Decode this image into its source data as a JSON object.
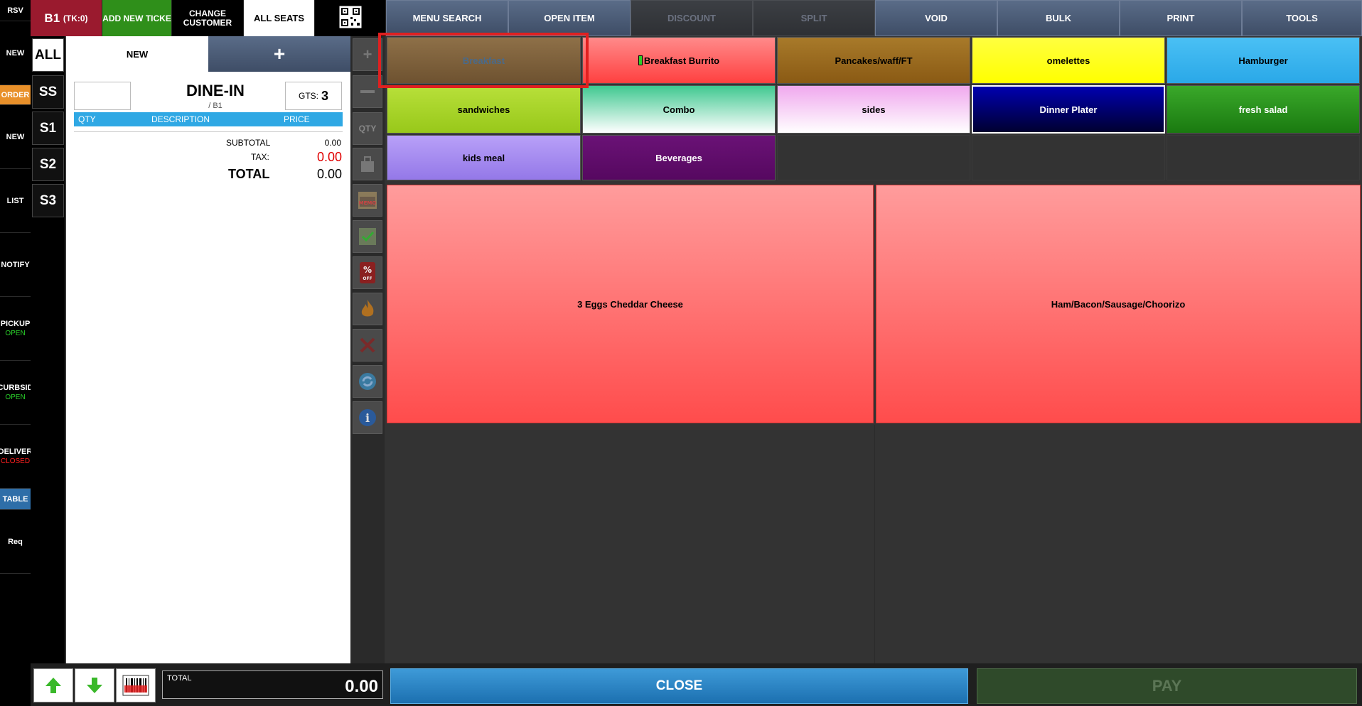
{
  "left_nav": [
    {
      "label": "RSV",
      "sub": ""
    },
    {
      "label": "NEW",
      "sub": ""
    },
    {
      "label": "ORDER",
      "sub": ""
    },
    {
      "label": "NEW",
      "sub": ""
    },
    {
      "label": "LIST",
      "sub": ""
    },
    {
      "label": "NOTIFY",
      "sub": ""
    },
    {
      "label": "PICKUP",
      "sub": "OPEN"
    },
    {
      "label": "CURBSID",
      "sub": "OPEN"
    },
    {
      "label": "DELIVER",
      "sub": "CLOSED"
    },
    {
      "label": "TABLE",
      "sub": ""
    },
    {
      "label": "Req",
      "sub": ""
    }
  ],
  "header": {
    "table_label": "B1",
    "table_sub": "(TK:0)",
    "add_ticket": "ADD NEW TICKE",
    "change_customer": "CHANGE CUSTOMER",
    "all_seats": "ALL SEATS",
    "menu_buttons": [
      "MENU SEARCH",
      "OPEN ITEM",
      "DISCOUNT",
      "SPLIT",
      "VOID",
      "BULK",
      "PRINT",
      "TOOLS"
    ]
  },
  "seats": [
    "ALL",
    "SS",
    "S1",
    "S2",
    "S3"
  ],
  "ticket": {
    "tab_new": "NEW",
    "tab_plus": "+",
    "order_type": "DINE-IN",
    "order_sub": "/ B1",
    "gts_label": "GTS:",
    "gts_value": "3",
    "col_qty": "QTY",
    "col_desc": "DESCRIPTION",
    "col_price": "PRICE",
    "subtotal_label": "SUBTOTAL",
    "subtotal_value": "0.00",
    "tax_label": "TAX:",
    "tax_value": "0.00",
    "total_label": "TOTAL",
    "total_value": "0.00"
  },
  "tools": [
    "plus-icon",
    "minus-icon",
    "QTY",
    "bag-icon",
    "memo-icon",
    "checklist-icon",
    "percent-off-icon",
    "fire-icon",
    "x-icon",
    "refresh-icon",
    "info-icon"
  ],
  "categories": [
    {
      "label": "Breakfast",
      "color": "#8b6a3e"
    },
    {
      "label": "Breakfast Burrito",
      "color": "#ff5252"
    },
    {
      "label": "Pancakes/waff/FT",
      "color": "#9a6a20"
    },
    {
      "label": "omelettes",
      "color": "#ffff00"
    },
    {
      "label": "Hamburger",
      "color": "#33b5f0"
    },
    {
      "label": "sandwiches",
      "color": "#a6d82a"
    },
    {
      "label": "Combo",
      "color": "#40d090"
    },
    {
      "label": "sides",
      "color": "#f2b8f0"
    },
    {
      "label": "Dinner Plater",
      "color": "#000090"
    },
    {
      "label": "fresh salad",
      "color": "#2a9a1a"
    },
    {
      "label": "kids meal",
      "color": "#a78cf0"
    },
    {
      "label": "Beverages",
      "color": "#600a6a"
    }
  ],
  "items": [
    "3 Eggs Cheddar Cheese",
    "Ham/Bacon/Sausage/Choorizo"
  ],
  "bottom": {
    "total_label": "TOTAL",
    "total_value": "0.00",
    "close": "CLOSE",
    "pay": "PAY"
  }
}
